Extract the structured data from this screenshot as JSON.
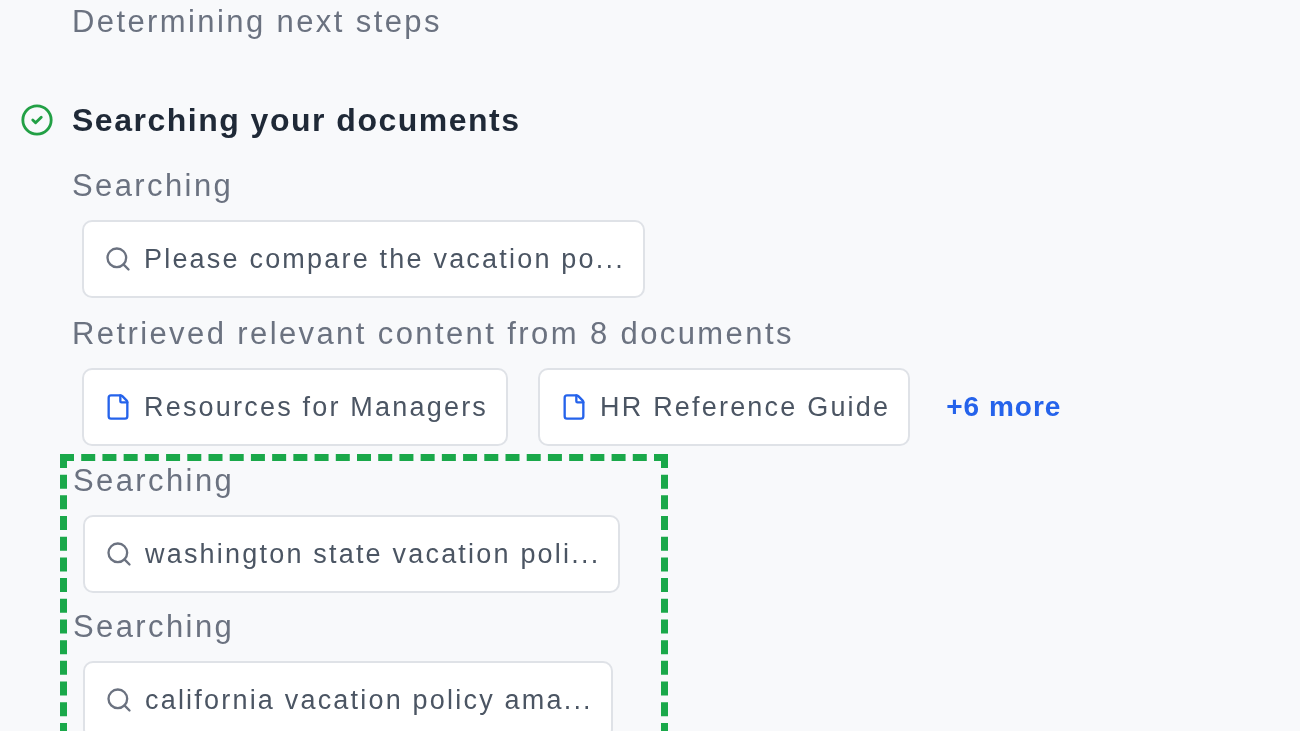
{
  "steps": [
    {
      "kind": "note",
      "text": "Determining next steps"
    },
    {
      "kind": "section",
      "title": "Searching your documents",
      "done": true,
      "items": [
        {
          "kind": "search",
          "label": "Searching",
          "query": "Please compare the vacation po...",
          "highlighted": false
        },
        {
          "kind": "results",
          "label": "Retrieved relevant content from 8 documents",
          "documents": [
            "Resources for Managers",
            "HR Reference Guide"
          ],
          "more": "+6 more",
          "highlighted": false
        },
        {
          "kind": "search",
          "label": "Searching",
          "query": "washington state vacation poli...",
          "highlighted": true
        },
        {
          "kind": "search",
          "label": "Searching",
          "query": "california vacation policy ama...",
          "highlighted": true
        }
      ]
    }
  ]
}
